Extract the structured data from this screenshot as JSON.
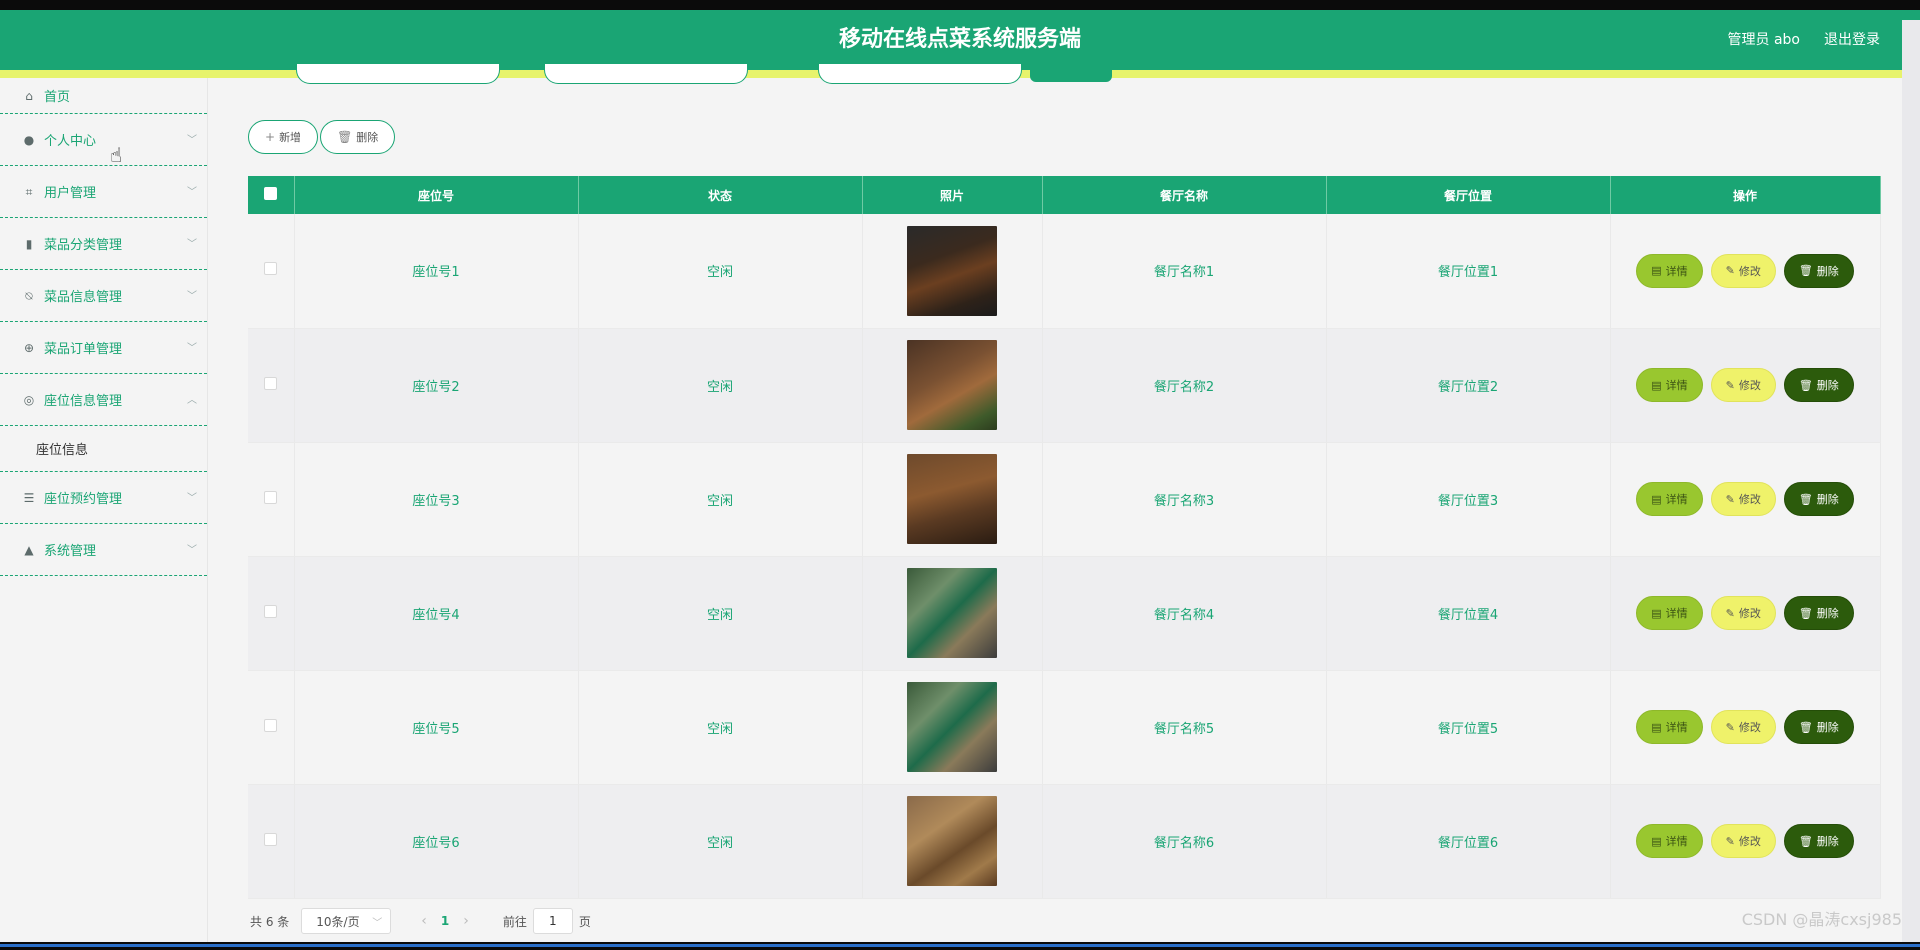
{
  "header": {
    "title": "移动在线点菜系统服务端",
    "user": "管理员 abo",
    "logout": "退出登录"
  },
  "sidebar": {
    "items": [
      {
        "label": "首页",
        "icon": "home-icon"
      },
      {
        "label": "个人中心",
        "icon": "person-icon"
      },
      {
        "label": "用户管理",
        "icon": "crop-icon"
      },
      {
        "label": "菜品分类管理",
        "icon": "bar-chart-icon"
      },
      {
        "label": "菜品信息管理",
        "icon": "bell-off-icon"
      },
      {
        "label": "菜品订单管理",
        "icon": "crosshair-icon"
      },
      {
        "label": "座位信息管理",
        "icon": "target-icon"
      },
      {
        "label": "座位预约管理",
        "icon": "list-icon"
      },
      {
        "label": "系统管理",
        "icon": "user-icon"
      }
    ],
    "sub_item": "座位信息"
  },
  "toolbar": {
    "add": "新增",
    "delete": "删除"
  },
  "table": {
    "headers": [
      "座位号",
      "状态",
      "照片",
      "餐厅名称",
      "餐厅位置",
      "操作"
    ],
    "rows": [
      {
        "seat": "座位号1",
        "status": "空闲",
        "name": "餐厅名称1",
        "location": "餐厅位置1"
      },
      {
        "seat": "座位号2",
        "status": "空闲",
        "name": "餐厅名称2",
        "location": "餐厅位置2"
      },
      {
        "seat": "座位号3",
        "status": "空闲",
        "name": "餐厅名称3",
        "location": "餐厅位置3"
      },
      {
        "seat": "座位号4",
        "status": "空闲",
        "name": "餐厅名称4",
        "location": "餐厅位置4"
      },
      {
        "seat": "座位号5",
        "status": "空闲",
        "name": "餐厅名称5",
        "location": "餐厅位置5"
      },
      {
        "seat": "座位号6",
        "status": "空闲",
        "name": "餐厅名称6",
        "location": "餐厅位置6"
      }
    ],
    "actions": {
      "detail": "详情",
      "edit": "修改",
      "delete": "删除"
    }
  },
  "pagination": {
    "total": "共 6 条",
    "page_size": "10条/页",
    "current": "1",
    "goto_prefix": "前往",
    "goto_value": "1",
    "goto_suffix": "页"
  },
  "watermark": "CSDN @晶涛cxsj985",
  "colors": {
    "primary": "#1aa574",
    "accent_strip": "#e7f36c",
    "detail_btn": "#99c72f",
    "edit_btn": "#eff26a",
    "delete_btn": "#2c5b0c"
  }
}
